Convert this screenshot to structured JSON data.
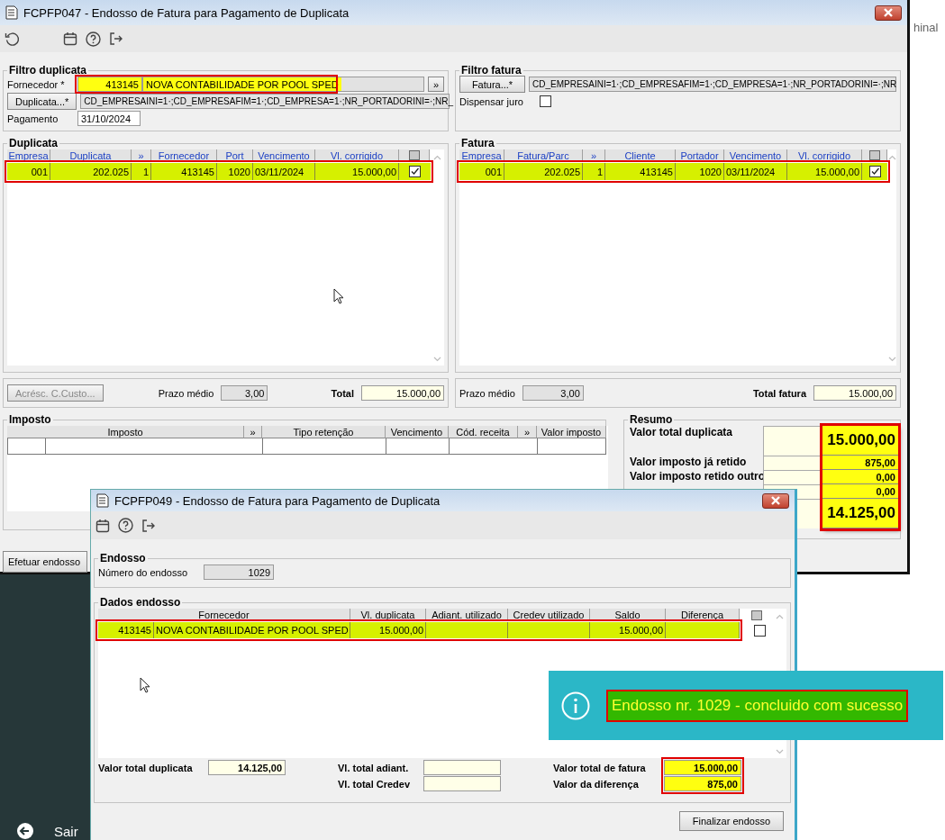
{
  "desktop": {
    "side_text": "hinal",
    "exit_label": "Sair"
  },
  "main_window": {
    "title": "FCPFP047 - Endosso de Fatura para Pagamento de Duplicata",
    "filtro_duplicata": {
      "title": "Filtro duplicata",
      "fornecedor_label": "Fornecedor *",
      "fornecedor_code": "413145",
      "fornecedor_name": "NOVA CONTABILIDADE POR POOL SPED",
      "highlighted": true,
      "more_button": "»",
      "duplicata_button": "Duplicata...*",
      "duplicata_filter": "CD_EMPRESAINI=1·;CD_EMPRESAFIM=1·;CD_EMPRESA=1·;NR_PORTADORINI=·;NR_",
      "pagamento_label": "Pagamento",
      "pagamento": "31/10/2024"
    },
    "filtro_fatura": {
      "title": "Filtro fatura",
      "fatura_button": "Fatura...*",
      "fatura_filter": "CD_EMPRESAINI=1·;CD_EMPRESAFIM=1·;CD_EMPRESA=1·;NR_PORTADORINI=·;NR",
      "dispensar_label": "Dispensar juro",
      "dispensar_checked": false
    },
    "duplicata": {
      "title": "Duplicata",
      "columns": [
        "Empresa",
        "Duplicata",
        "»",
        "Fornecedor",
        "Port",
        "Vencimento",
        "Vl. corrigido"
      ],
      "rows": [
        {
          "cells": [
            "001",
            "202.025",
            "1",
            "413145",
            "1020",
            "03/11/2024",
            "15.000,00"
          ],
          "checked": true,
          "highlighted": true
        }
      ],
      "acresc_button": "Acrésc. C.Custo...",
      "acresc_disabled": true,
      "prazo_label": "Prazo médio",
      "prazo": "3,00",
      "total_label": "Total",
      "total": "15.000,00"
    },
    "fatura": {
      "title": "Fatura",
      "columns": [
        "Empresa",
        "Fatura/Parc",
        "»",
        "Cliente",
        "Portador",
        "Vencimento",
        "Vl. corrigido"
      ],
      "rows": [
        {
          "cells": [
            "001",
            "202.025",
            "1",
            "413145",
            "1020",
            "03/11/2024",
            "15.000,00"
          ],
          "checked": true,
          "highlighted": true
        }
      ],
      "prazo_label": "Prazo médio",
      "prazo": "3,00",
      "total_label": "Total fatura",
      "total": "15.000,00"
    },
    "imposto": {
      "title": "Imposto",
      "columns": [
        "Imposto",
        "»",
        "Tipo retenção",
        "Vencimento",
        "Cód. receita",
        "»",
        "Valor imposto"
      ]
    },
    "resumo": {
      "title": "Resumo",
      "highlighted": true,
      "rows": [
        {
          "label": "Valor total duplicata",
          "value": "15.000,00",
          "kind": "big"
        },
        {
          "label": "Valor imposto já retido",
          "value": "875,00",
          "kind": "small"
        },
        {
          "label": "Valor imposto retido outro",
          "value": "0,00",
          "kind": "small"
        },
        {
          "value": "0,00",
          "kind": "small"
        },
        {
          "value": "14.125,00",
          "kind": "big"
        }
      ]
    },
    "efetuar_button": "Efetuar endosso"
  },
  "dialog": {
    "title": "FCPFP049 - Endosso de Fatura para Pagamento de Duplicata",
    "endosso": {
      "title": "Endosso",
      "numero_label": "Número do endosso",
      "numero": "1029"
    },
    "dados": {
      "title": "Dados endosso",
      "columns": [
        "Fornecedor",
        "Vl. duplicata",
        "Adiant. utilizado",
        "Credev utilizado",
        "Saldo",
        "Diferença"
      ],
      "rows": [
        {
          "code": "413145",
          "name": "NOVA CONTABILIDADE POR POOL SPED",
          "vl_duplicata": "15.000,00",
          "saldo": "15.000,00",
          "checked": false,
          "highlighted": true
        }
      ],
      "total_duplicata_label": "Valor total duplicata",
      "total_duplicata": "14.125,00",
      "total_adiant_label": "Vl. total adiant.",
      "total_credev_label": "Vl. total Credev",
      "total_fatura_label": "Valor total de fatura",
      "total_fatura": "15.000,00",
      "diferenca_label": "Valor da diferença",
      "diferenca": "875,00",
      "totals_highlighted": true
    },
    "finalizar_button": "Finalizar endosso"
  },
  "toast": {
    "message": "Endosso nr. 1029 - concluido com sucesso",
    "highlighted": true
  }
}
